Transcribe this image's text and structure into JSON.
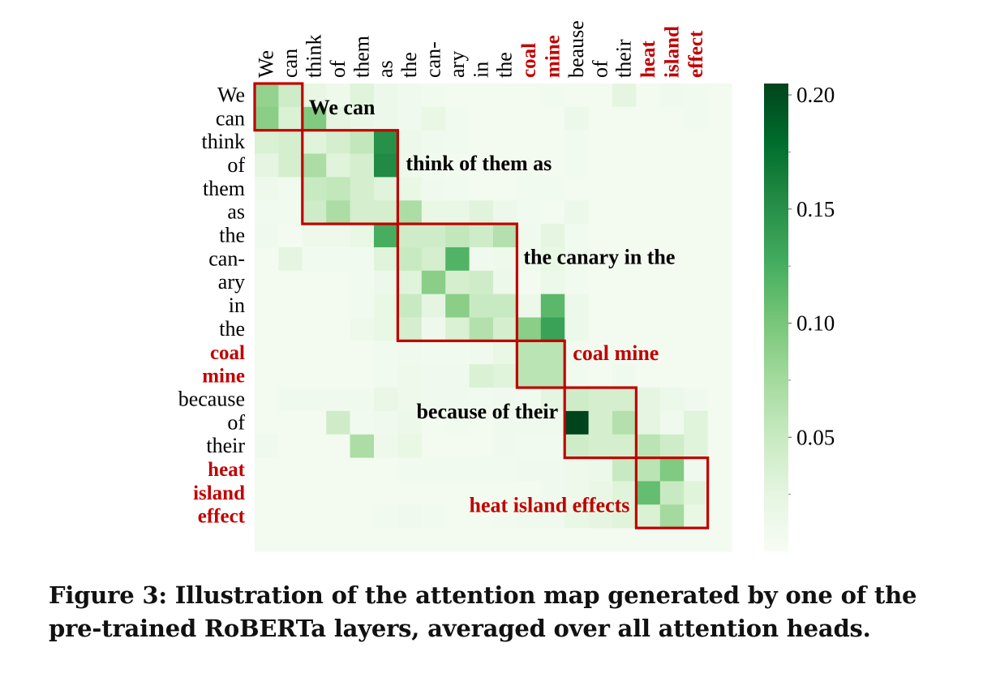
{
  "chart_data": {
    "type": "heatmap",
    "title": "",
    "xlabel": "",
    "ylabel": "",
    "x_tokens": [
      "We",
      "can",
      "think",
      "of",
      "them",
      "as",
      "the",
      "can-",
      "ary",
      "in",
      "the",
      "coal",
      "mine",
      "beause",
      "of",
      "their",
      "heat",
      "island",
      "effect"
    ],
    "y_tokens": [
      "We",
      "can",
      "think",
      "of",
      "them",
      "as",
      "the",
      "can-",
      "ary",
      "in",
      "the",
      "coal",
      "mine",
      "because",
      "of",
      "their",
      "heat",
      "island",
      "effect"
    ],
    "highlight_tokens": [
      "coal",
      "mine",
      "heat",
      "island",
      "effect"
    ],
    "values": [
      [
        0.085,
        0.045,
        0.022,
        0.012,
        0.03,
        0.015,
        0.01,
        0.008,
        0.006,
        0.006,
        0.006,
        0.006,
        0.008,
        0.006,
        0.006,
        0.025,
        0.006,
        0.01,
        0.008,
        0.006
      ],
      [
        0.09,
        0.035,
        0.095,
        0.025,
        0.018,
        0.015,
        0.01,
        0.02,
        0.008,
        0.006,
        0.006,
        0.006,
        0.006,
        0.015,
        0.006,
        0.006,
        0.006,
        0.006,
        0.008,
        0.006
      ],
      [
        0.035,
        0.04,
        0.03,
        0.04,
        0.055,
        0.15,
        0.015,
        0.01,
        0.008,
        0.006,
        0.006,
        0.006,
        0.006,
        0.008,
        0.006,
        0.006,
        0.006,
        0.006,
        0.006,
        0.006
      ],
      [
        0.025,
        0.04,
        0.07,
        0.03,
        0.04,
        0.155,
        0.012,
        0.008,
        0.006,
        0.006,
        0.006,
        0.006,
        0.006,
        0.008,
        0.006,
        0.006,
        0.006,
        0.006,
        0.006,
        0.006
      ],
      [
        0.012,
        0.008,
        0.05,
        0.055,
        0.04,
        0.03,
        0.02,
        0.01,
        0.008,
        0.006,
        0.006,
        0.008,
        0.008,
        0.006,
        0.006,
        0.006,
        0.006,
        0.006,
        0.006,
        0.006
      ],
      [
        0.008,
        0.008,
        0.045,
        0.07,
        0.04,
        0.04,
        0.07,
        0.02,
        0.02,
        0.03,
        0.015,
        0.008,
        0.006,
        0.015,
        0.006,
        0.006,
        0.006,
        0.006,
        0.006,
        0.006
      ],
      [
        0.01,
        0.006,
        0.012,
        0.012,
        0.02,
        0.125,
        0.045,
        0.045,
        0.055,
        0.045,
        0.065,
        0.01,
        0.025,
        0.008,
        0.006,
        0.006,
        0.006,
        0.006,
        0.006,
        0.006
      ],
      [
        0.006,
        0.025,
        0.008,
        0.008,
        0.008,
        0.03,
        0.05,
        0.04,
        0.12,
        0.01,
        0.012,
        0.01,
        0.02,
        0.008,
        0.006,
        0.006,
        0.006,
        0.006,
        0.006,
        0.006
      ],
      [
        0.006,
        0.006,
        0.006,
        0.006,
        0.008,
        0.015,
        0.03,
        0.09,
        0.04,
        0.045,
        0.015,
        0.006,
        0.015,
        0.008,
        0.006,
        0.006,
        0.006,
        0.006,
        0.006,
        0.006
      ],
      [
        0.006,
        0.006,
        0.006,
        0.006,
        0.008,
        0.02,
        0.05,
        0.025,
        0.09,
        0.05,
        0.05,
        0.015,
        0.115,
        0.015,
        0.006,
        0.006,
        0.006,
        0.006,
        0.006,
        0.006
      ],
      [
        0.006,
        0.006,
        0.006,
        0.006,
        0.012,
        0.02,
        0.04,
        0.012,
        0.035,
        0.065,
        0.04,
        0.09,
        0.135,
        0.015,
        0.006,
        0.006,
        0.006,
        0.006,
        0.006,
        0.006
      ],
      [
        0.006,
        0.006,
        0.006,
        0.006,
        0.006,
        0.008,
        0.01,
        0.008,
        0.008,
        0.01,
        0.02,
        0.06,
        0.06,
        0.008,
        0.006,
        0.006,
        0.006,
        0.006,
        0.006,
        0.006
      ],
      [
        0.006,
        0.006,
        0.006,
        0.006,
        0.006,
        0.008,
        0.012,
        0.01,
        0.01,
        0.035,
        0.03,
        0.06,
        0.06,
        0.008,
        0.006,
        0.01,
        0.006,
        0.006,
        0.006,
        0.006
      ],
      [
        0.006,
        0.01,
        0.01,
        0.01,
        0.01,
        0.018,
        0.012,
        0.01,
        0.01,
        0.008,
        0.01,
        0.008,
        0.025,
        0.045,
        0.04,
        0.04,
        0.025,
        0.015,
        0.01,
        0.006
      ],
      [
        0.006,
        0.006,
        0.006,
        0.045,
        0.008,
        0.01,
        0.015,
        0.006,
        0.008,
        0.006,
        0.01,
        0.01,
        0.01,
        0.205,
        0.04,
        0.065,
        0.025,
        0.01,
        0.03,
        0.006
      ],
      [
        0.01,
        0.006,
        0.006,
        0.006,
        0.07,
        0.012,
        0.02,
        0.006,
        0.006,
        0.006,
        0.01,
        0.008,
        0.008,
        0.045,
        0.04,
        0.04,
        0.06,
        0.045,
        0.03,
        0.006
      ],
      [
        0.006,
        0.006,
        0.006,
        0.006,
        0.006,
        0.006,
        0.008,
        0.008,
        0.008,
        0.008,
        0.008,
        0.01,
        0.01,
        0.012,
        0.015,
        0.05,
        0.06,
        0.095,
        0.01,
        0.006
      ],
      [
        0.006,
        0.006,
        0.006,
        0.006,
        0.006,
        0.006,
        0.006,
        0.006,
        0.006,
        0.006,
        0.006,
        0.006,
        0.01,
        0.012,
        0.018,
        0.03,
        0.11,
        0.05,
        0.03,
        0.006
      ],
      [
        0.006,
        0.006,
        0.006,
        0.006,
        0.006,
        0.008,
        0.01,
        0.008,
        0.006,
        0.006,
        0.008,
        0.01,
        0.01,
        0.02,
        0.025,
        0.03,
        0.035,
        0.075,
        0.02,
        0.006
      ],
      [
        0.006,
        0.006,
        0.006,
        0.006,
        0.006,
        0.006,
        0.006,
        0.006,
        0.006,
        0.006,
        0.006,
        0.006,
        0.006,
        0.006,
        0.006,
        0.006,
        0.006,
        0.006,
        0.006,
        0.006
      ]
    ],
    "colormap": "Greens",
    "vmin": 0.0,
    "vmax": 0.205,
    "colorbar": {
      "ticks": [
        0.05,
        0.1,
        0.15,
        0.2
      ],
      "tick_labels": [
        "0.05",
        "0.10",
        "0.15",
        "0.20"
      ],
      "minor_ticks": [
        0.025,
        0.075,
        0.125,
        0.175
      ]
    },
    "phrase_boxes": [
      {
        "label": "We can",
        "rows": [
          0,
          1
        ],
        "cols": [
          0,
          1
        ],
        "highlight": false
      },
      {
        "label": "think of them as",
        "rows": [
          2,
          5
        ],
        "cols": [
          2,
          5
        ],
        "highlight": false
      },
      {
        "label": "the canary in the",
        "rows": [
          6,
          10
        ],
        "cols": [
          6,
          10
        ],
        "highlight": false
      },
      {
        "label": "coal mine",
        "rows": [
          11,
          12
        ],
        "cols": [
          11,
          12
        ],
        "highlight": true
      },
      {
        "label": "because of their",
        "rows": [
          13,
          15
        ],
        "cols": [
          13,
          15
        ],
        "highlight": false
      },
      {
        "label": "heat island effects",
        "rows": [
          16,
          18
        ],
        "cols": [
          16,
          18
        ],
        "highlight": true
      }
    ],
    "colors": {
      "box": "#c00000",
      "highlight_text": "#c00000",
      "text": "#000000"
    }
  },
  "caption": {
    "line1": "Figure 3: Illustration of the attention map generated by one of the",
    "line2": "pre-trained RoBERTa layers, averaged over all attention heads."
  }
}
